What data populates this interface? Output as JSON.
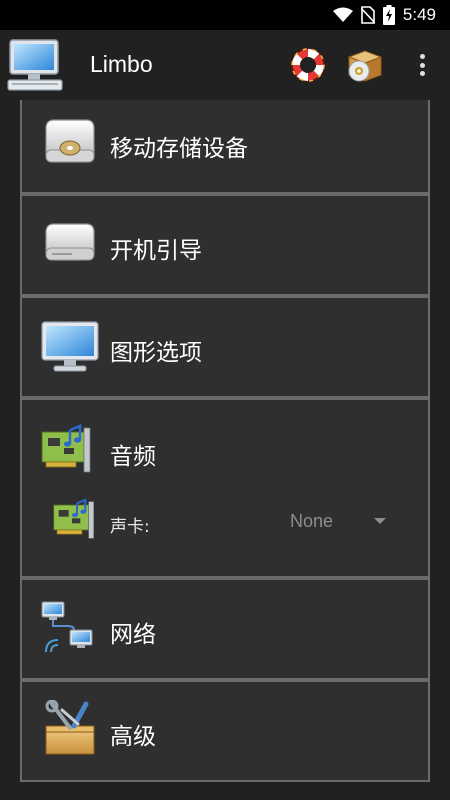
{
  "status_bar": {
    "time": "5:49",
    "icons": [
      "wifi-icon",
      "no-sim-icon",
      "battery-charging-icon"
    ]
  },
  "app_bar": {
    "title": "Limbo",
    "actions": [
      "help-lifebuoy-icon",
      "cd-box-icon",
      "overflow-menu-icon"
    ]
  },
  "sections": [
    {
      "label": "移动存储设备",
      "icon": "removable-drive-icon"
    },
    {
      "label": "开机引导",
      "icon": "boot-drive-icon"
    },
    {
      "label": "图形选项",
      "icon": "monitor-icon"
    },
    {
      "label": "音频",
      "icon": "sound-card-icon",
      "fields": [
        {
          "label": "声卡:",
          "value": "None",
          "icon": "sound-card-icon"
        }
      ]
    },
    {
      "label": "网络",
      "icon": "network-icon"
    },
    {
      "label": "高级",
      "icon": "tools-box-icon"
    }
  ],
  "colors": {
    "background": "#212121",
    "panel": "#2f2f2f",
    "panel_border": "#6b6b6b",
    "text": "#ffffff",
    "muted": "#8e8e8e"
  }
}
